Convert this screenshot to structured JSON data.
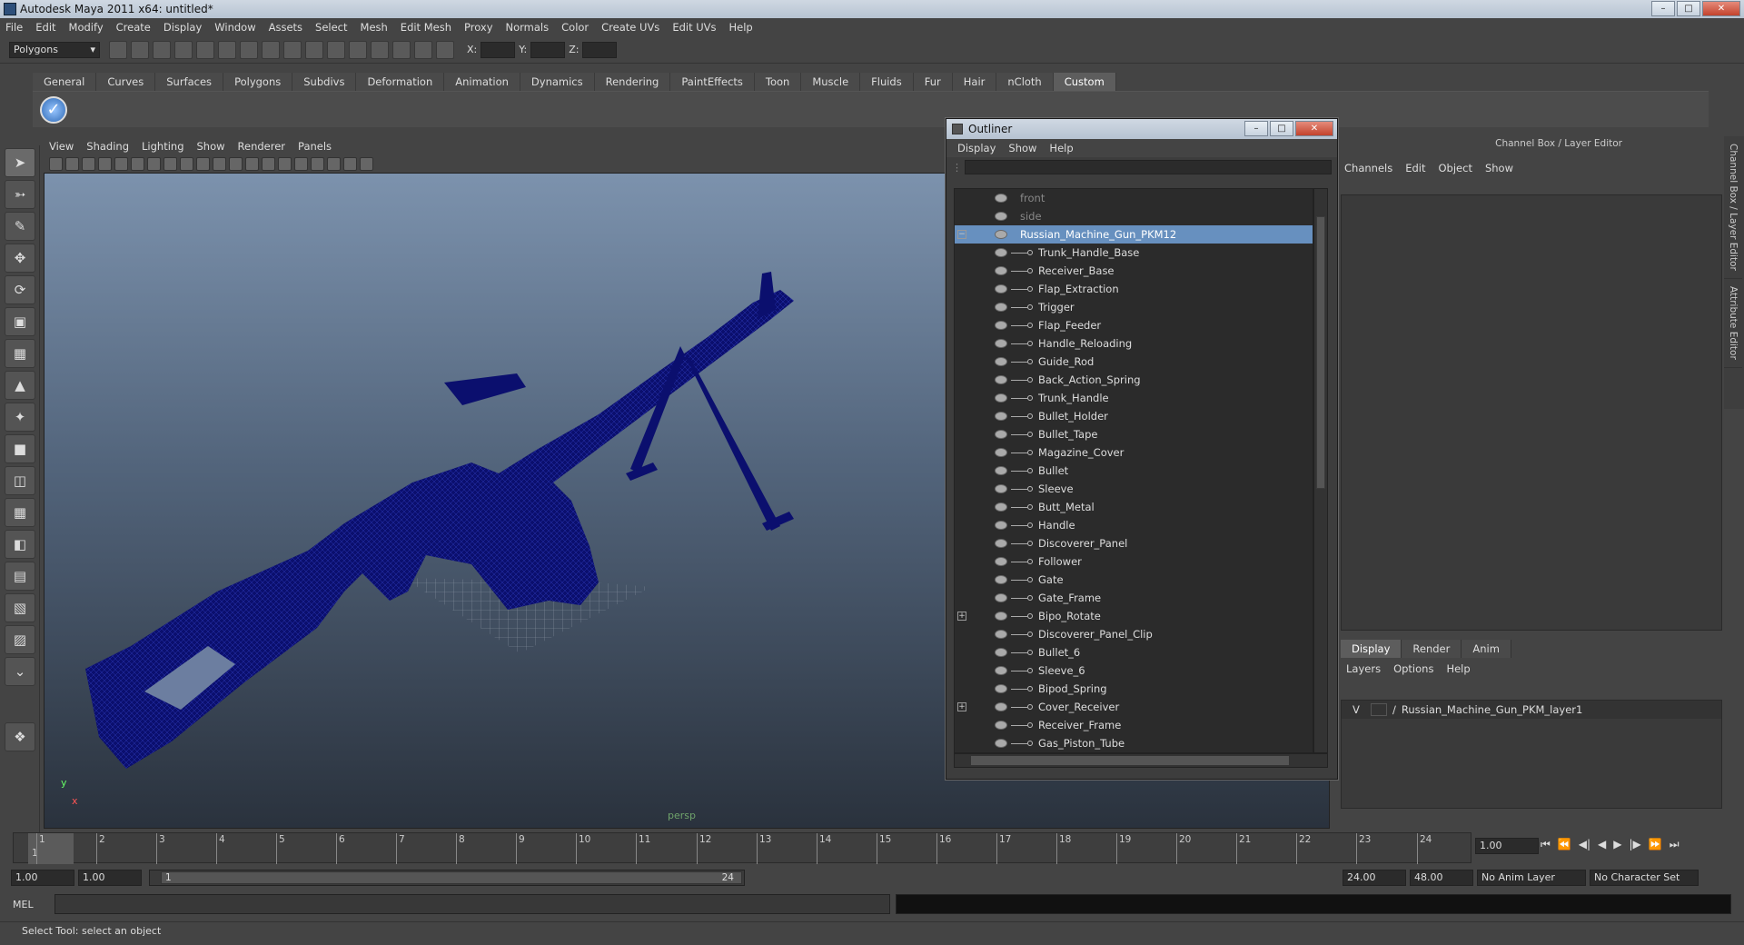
{
  "window": {
    "title": "Autodesk Maya 2011 x64: untitled*"
  },
  "menubar": [
    "File",
    "Edit",
    "Modify",
    "Create",
    "Display",
    "Window",
    "Assets",
    "Select",
    "Mesh",
    "Edit Mesh",
    "Proxy",
    "Normals",
    "Color",
    "Create UVs",
    "Edit UVs",
    "Help"
  ],
  "statusline": {
    "mode": "Polygons",
    "x_label": "X:",
    "y_label": "Y:",
    "z_label": "Z:"
  },
  "shelf_tabs": [
    "General",
    "Curves",
    "Surfaces",
    "Polygons",
    "Subdivs",
    "Deformation",
    "Animation",
    "Dynamics",
    "Rendering",
    "PaintEffects",
    "Toon",
    "Muscle",
    "Fluids",
    "Fur",
    "Hair",
    "nCloth",
    "Custom"
  ],
  "shelf_active": "Custom",
  "viewport": {
    "menu": [
      "View",
      "Shading",
      "Lighting",
      "Show",
      "Renderer",
      "Panels"
    ],
    "camera": "persp",
    "axis_y": "y",
    "axis_x": "x",
    "wire_color": "#0b0f6e"
  },
  "outliner": {
    "title": "Outliner",
    "menu": [
      "Display",
      "Show",
      "Help"
    ],
    "top_items": [
      "front",
      "side"
    ],
    "root": "Russian_Machine_Gun_PKM12",
    "children": [
      "Trunk_Handle_Base",
      "Receiver_Base",
      "Flap_Extraction",
      "Trigger",
      "Flap_Feeder",
      "Handle_Reloading",
      "Guide_Rod",
      "Back_Action_Spring",
      "Trunk_Handle",
      "Bullet_Holder",
      "Bullet_Tape",
      "Magazine_Cover",
      "Bullet",
      "Sleeve",
      "Butt_Metal",
      "Handle",
      "Discoverer_Panel",
      "Follower",
      "Gate",
      "Gate_Frame",
      "Bipo_Rotate",
      "Discoverer_Panel_Clip",
      "Bullet_6",
      "Sleeve_6",
      "Bipod_Spring",
      "Cover_Receiver",
      "Receiver_Frame",
      "Gas_Piston_Tube"
    ],
    "expandable": [
      "Bipo_Rotate",
      "Cover_Receiver"
    ]
  },
  "channelbox": {
    "header": "Channel Box / Layer Editor",
    "menu": [
      "Channels",
      "Edit",
      "Object",
      "Show"
    ],
    "layer_tabs": [
      "Display",
      "Render",
      "Anim"
    ],
    "layer_menu": [
      "Layers",
      "Options",
      "Help"
    ],
    "layer": {
      "visible": "V",
      "name": "Russian_Machine_Gun_PKM_layer1"
    },
    "side_tabs": [
      "Channel Box / Layer Editor",
      "Attribute Editor"
    ]
  },
  "timeline": {
    "ticks": [
      "1",
      "2",
      "3",
      "4",
      "5",
      "6",
      "7",
      "8",
      "9",
      "10",
      "11",
      "12",
      "13",
      "14",
      "15",
      "16",
      "17",
      "18",
      "19",
      "20",
      "21",
      "22",
      "23",
      "24"
    ],
    "current_frame": "1",
    "current_time": "1.00"
  },
  "range": {
    "start_time": "1.00",
    "start_range": "1.00",
    "slider_start": "1",
    "slider_end": "24",
    "end_range": "24.00",
    "end_time": "48.00",
    "anim_layer": "No Anim Layer",
    "char_set": "No Character Set"
  },
  "cmd": {
    "label": "MEL"
  },
  "help_line": "Select Tool: select an object"
}
